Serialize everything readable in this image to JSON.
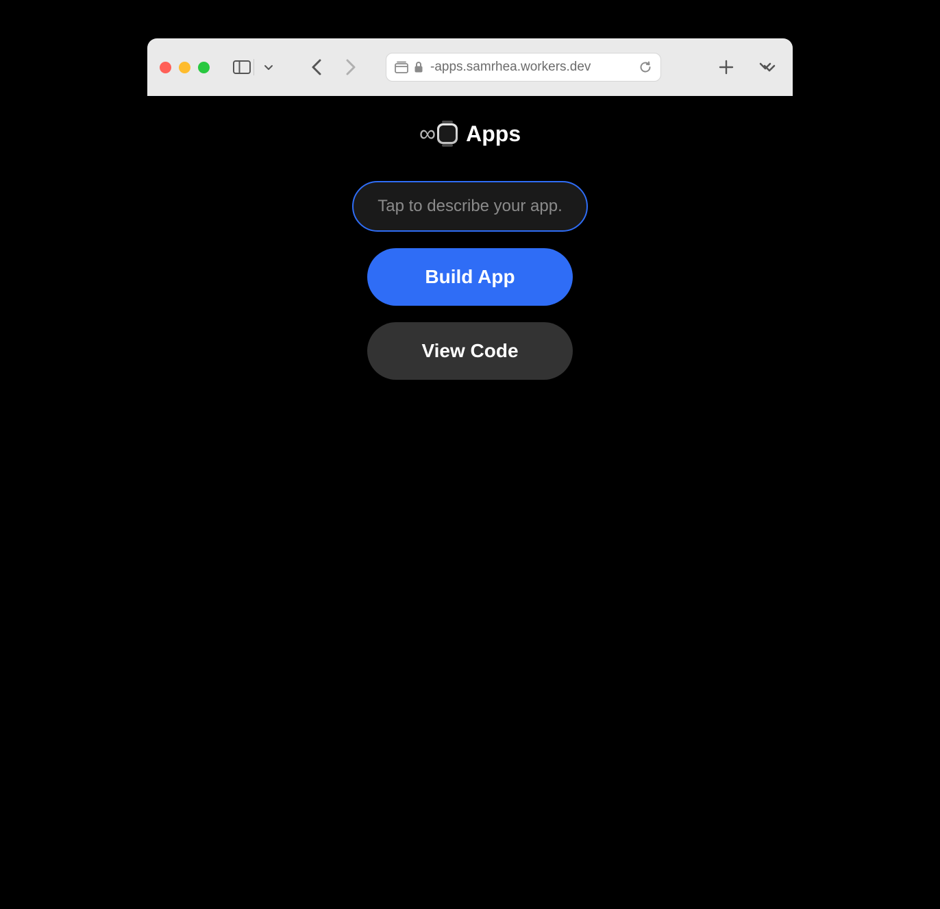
{
  "browser": {
    "address_text": "-apps.samrhea.workers.dev"
  },
  "header": {
    "infinity_glyph": "∞",
    "title": "Apps"
  },
  "form": {
    "input_placeholder": "Tap to describe your app.",
    "build_button": "Build App",
    "view_code_button": "View Code"
  }
}
